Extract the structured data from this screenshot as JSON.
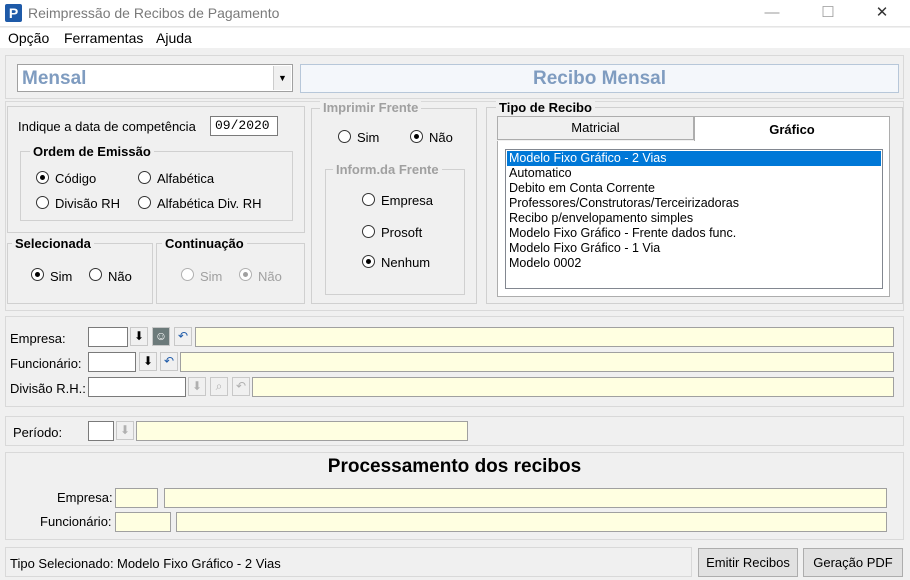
{
  "window": {
    "title": "Reimpressão de Recibos de Pagamento",
    "app_icon_letter": "P",
    "minimize": "—",
    "maximize": "☐",
    "close": "✕"
  },
  "menu": [
    "Opção",
    "Ferramentas",
    "Ajuda"
  ],
  "top": {
    "mode_select_value": "Mensal",
    "banner_title": "Recibo Mensal"
  },
  "competencia": {
    "label": "Indique a data de competência",
    "value": "09/2020"
  },
  "ordem": {
    "title": "Ordem de Emissão",
    "options": [
      "Código",
      "Alfabética",
      "Divisão RH",
      "Alfabética Div. RH"
    ],
    "selected": "Código"
  },
  "selecionada": {
    "title": "Selecionada",
    "sim": "Sim",
    "nao": "Não",
    "selected": "Sim"
  },
  "continuacao": {
    "title": "Continuação",
    "sim": "Sim",
    "nao": "Não",
    "selected": "Não"
  },
  "imprimir_frente": {
    "title": "Imprimir Frente",
    "sim": "Sim",
    "nao": "Não",
    "selected": "Não"
  },
  "inform_frente": {
    "title": "Inform.da Frente",
    "options": [
      "Empresa",
      "Prosoft",
      "Nenhum"
    ],
    "selected": "Nenhum"
  },
  "tipo_recibo": {
    "title": "Tipo de Recibo",
    "tabs": [
      "Matricial",
      "Gráfico"
    ],
    "active_tab": "Gráfico",
    "items": [
      "Modelo Fixo Gráfico - 2 Vias",
      "Automatico",
      "Debito em Conta Corrente",
      "Professores/Construtoras/Terceirizadoras",
      "Recibo p/envelopamento simples",
      "Modelo Fixo Gráfico - Frente dados func.",
      "Modelo Fixo Gráfico - 1 Via",
      "Modelo 0002"
    ],
    "selected_index": 0
  },
  "filtros": {
    "empresa_label": "Empresa:",
    "funcionario_label": "Funcionário:",
    "divisao_label": "Divisão R.H.:",
    "periodo_label": "Período:"
  },
  "processamento": {
    "title": "Processamento dos recibos",
    "empresa_label": "Empresa:",
    "funcionario_label": "Funcionário:"
  },
  "status": {
    "label": "Tipo Selecionado:",
    "value": "Modelo Fixo Gráfico - 2 Vias"
  },
  "buttons": {
    "emitir": "Emitir Recibos",
    "pdf": "Geração PDF"
  }
}
